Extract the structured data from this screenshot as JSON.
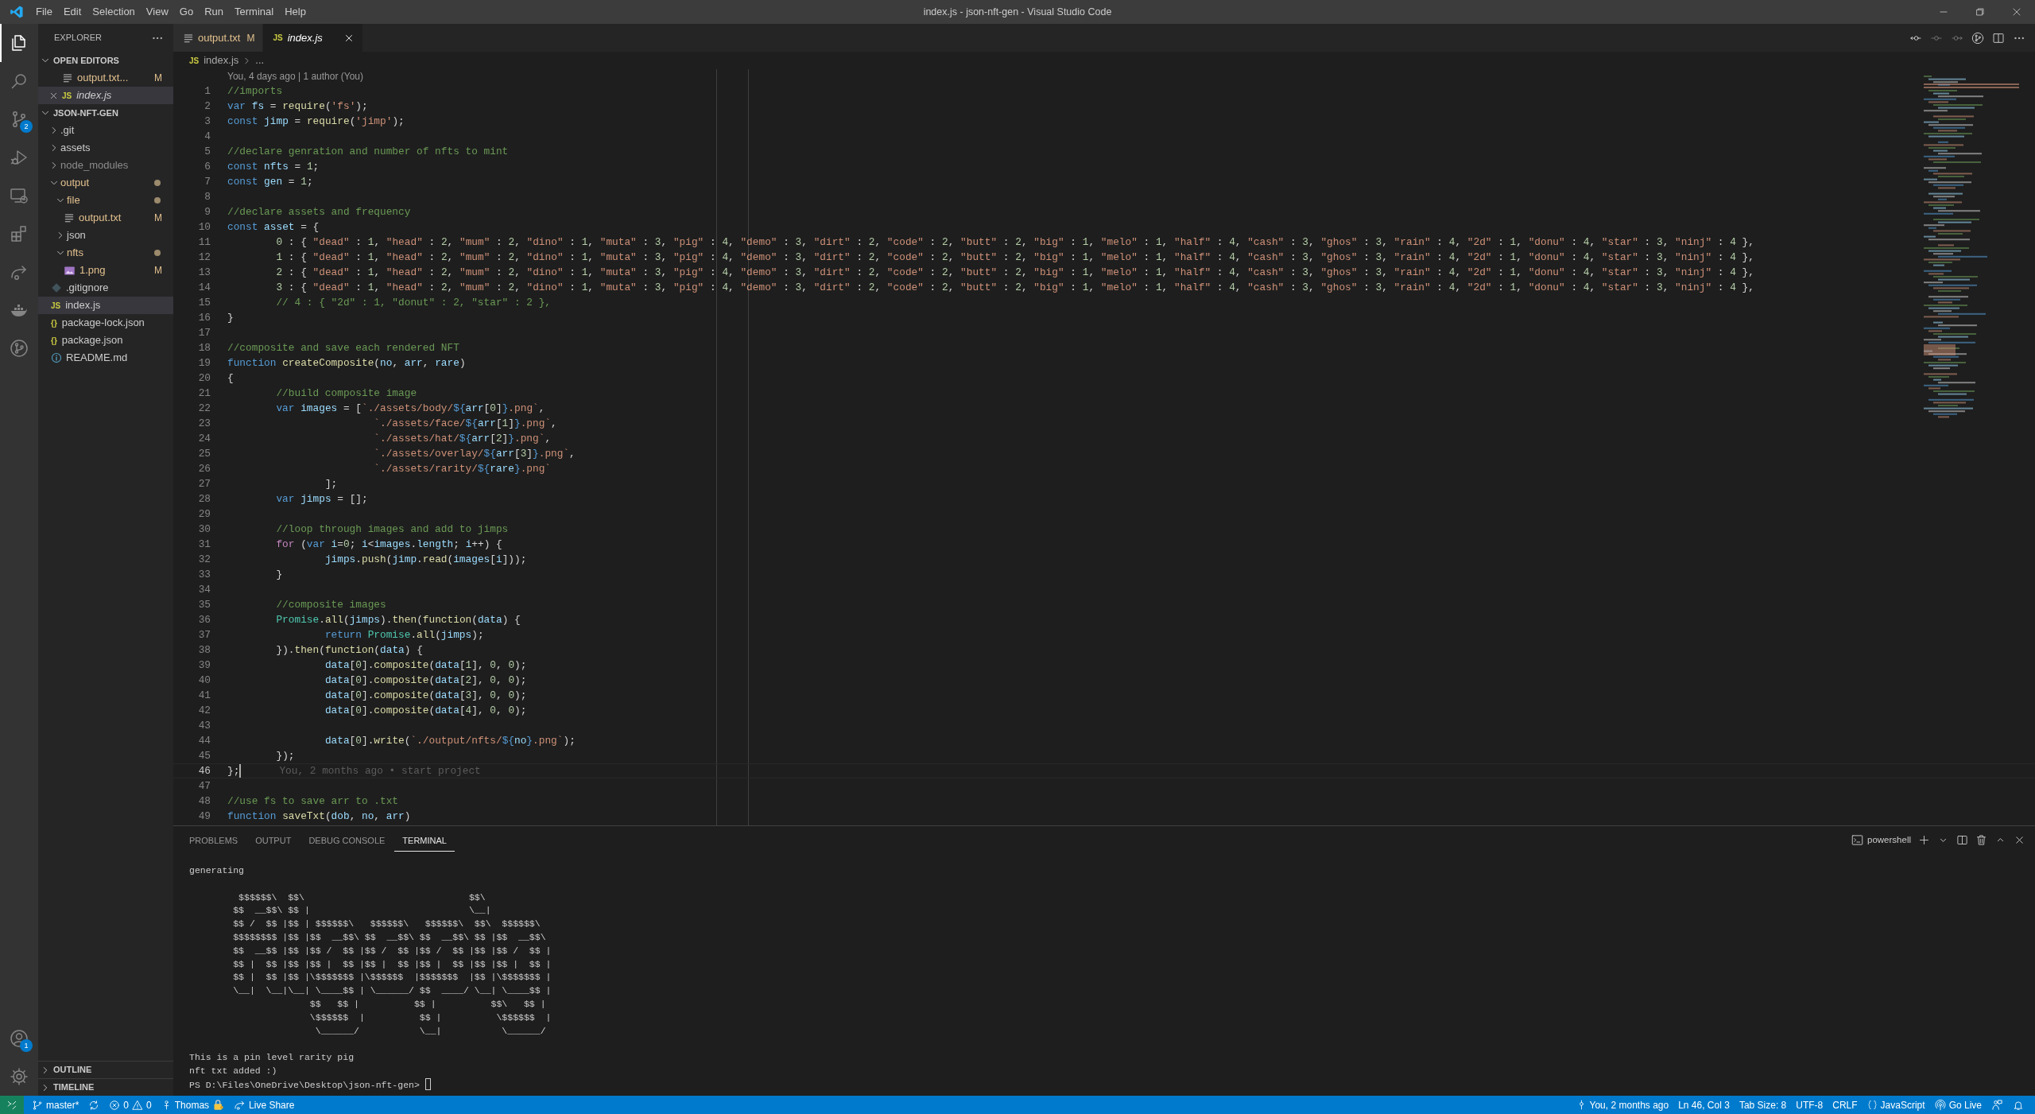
{
  "window": {
    "title": "index.js - json-nft-gen - Visual Studio Code"
  },
  "menu": [
    "File",
    "Edit",
    "Selection",
    "View",
    "Go",
    "Run",
    "Terminal",
    "Help"
  ],
  "activity_bar": {
    "items": [
      {
        "selected": true
      },
      {
        "selected": false
      },
      {
        "selected": false,
        "badge": "2"
      },
      {
        "selected": false
      },
      {
        "selected": false
      },
      {
        "selected": false
      },
      {
        "selected": false
      },
      {
        "selected": false
      },
      {
        "selected": false
      }
    ],
    "bottom": [
      {
        "selected": false,
        "badge": "1"
      },
      {
        "selected": false
      }
    ]
  },
  "sidebar": {
    "title": "EXPLORER",
    "open_editors": {
      "title": "OPEN EDITORS",
      "expanded": true,
      "items": [
        {
          "label": "output.txt...",
          "kind": "text-file",
          "modified": true,
          "ignored": false,
          "badge": "M",
          "selected": false,
          "preview": false
        },
        {
          "label": "index.js",
          "kind": "script-file",
          "glyph": "JS",
          "modified": false,
          "ignored": false,
          "selected": true,
          "preview": true
        }
      ]
    },
    "project": {
      "title": "JSON-NFT-GEN",
      "expanded": true,
      "items": [
        {
          "label": ".git",
          "kind": "folder",
          "expanded": false,
          "modified": false,
          "ignored": false,
          "selected": false
        },
        {
          "label": "assets",
          "kind": "folder",
          "expanded": false,
          "modified": false,
          "ignored": false,
          "selected": false
        },
        {
          "label": "node_modules",
          "kind": "folder",
          "expanded": false,
          "modified": false,
          "ignored": true,
          "selected": false
        },
        {
          "label": "output",
          "kind": "folder",
          "expanded": true,
          "modified": true,
          "ignored": false,
          "selected": false,
          "children": [
            {
              "label": "file",
              "kind": "folder",
              "expanded": true,
              "modified": true,
              "ignored": false,
              "selected": false,
              "children": [
                {
                  "label": "output.txt",
                  "kind": "text-file",
                  "modified": true,
                  "ignored": false,
                  "badge": "M",
                  "selected": false
                }
              ]
            },
            {
              "label": "json",
              "kind": "folder",
              "expanded": false,
              "modified": false,
              "ignored": false,
              "selected": false
            },
            {
              "label": "nfts",
              "kind": "folder",
              "expanded": true,
              "modified": true,
              "ignored": false,
              "selected": false,
              "children": [
                {
                  "label": "1.png",
                  "kind": "image-file",
                  "modified": true,
                  "ignored": false,
                  "badge": "M",
                  "selected": false
                }
              ]
            }
          ]
        },
        {
          "label": ".gitignore",
          "kind": "config-file",
          "modified": false,
          "ignored": false,
          "selected": false
        },
        {
          "label": "index.js",
          "kind": "script-file",
          "glyph": "JS",
          "modified": false,
          "ignored": false,
          "selected": true
        },
        {
          "label": "package-lock.json",
          "kind": "data-file",
          "glyph": "{}",
          "modified": false,
          "ignored": false,
          "selected": false
        },
        {
          "label": "package.json",
          "kind": "data-file",
          "glyph": "{}",
          "modified": false,
          "ignored": false,
          "selected": false
        },
        {
          "label": "README.md",
          "kind": "doc-file",
          "modified": false,
          "ignored": false,
          "selected": false
        }
      ]
    },
    "bottom_sections": [
      {
        "title": "OUTLINE",
        "expanded": false
      },
      {
        "title": "TIMELINE",
        "expanded": false
      }
    ]
  },
  "tabs": [
    {
      "label": "output.txt",
      "kind": "text-file",
      "modified": true,
      "badge": "M",
      "selected": false,
      "preview": false
    },
    {
      "label": "index.js",
      "kind": "script-file",
      "glyph": "JS",
      "modified": false,
      "selected": true,
      "preview": true
    }
  ],
  "breadcrumb": {
    "kind": "script-file",
    "glyph": "JS",
    "items": [
      "index.js",
      "..."
    ]
  },
  "editor": {
    "codelens": "You, 4 days ago | 1 author (You)",
    "lines": [
      {
        "number": "1",
        "current": false,
        "text": "//imports"
      },
      {
        "number": "2",
        "current": false,
        "text": "var fs = require('fs');"
      },
      {
        "number": "3",
        "current": false,
        "text": "const jimp = require('jimp');"
      },
      {
        "number": "4",
        "current": false
      },
      {
        "number": "5",
        "current": false,
        "text": "//declare genration and number of nfts to mint"
      },
      {
        "number": "6",
        "current": false,
        "text": "const nfts = 1;"
      },
      {
        "number": "7",
        "current": false,
        "text": "const gen = 1;"
      },
      {
        "number": "8",
        "current": false
      },
      {
        "number": "9",
        "current": false,
        "text": "//declare assets and frequency"
      },
      {
        "number": "10",
        "current": false,
        "text": "const asset = {"
      },
      {
        "number": "11",
        "current": false,
        "text": "\t0 : { \"dead\" : 1, \"head\" : 2, \"mum\" : 2, \"dino\" : 1, \"muta\" : 3, \"pig\" : 4, \"demo\" : 3, \"dirt\" : 2, \"code\" : 2, \"butt\" : 2, \"big\" : 1, \"melo\" : 1, \"half\" : 4, \"cash\" : 3, \"ghos\" : 3, \"rain\" : 4, \"2d\" : 1, \"donu\" : 4, \"star\" : 3, \"ninj\" : 4 },"
      },
      {
        "number": "12",
        "current": false,
        "text": "\t1 : { \"dead\" : 1, \"head\" : 2, \"mum\" : 2, \"dino\" : 1, \"muta\" : 3, \"pig\" : 4, \"demo\" : 3, \"dirt\" : 2, \"code\" : 2, \"butt\" : 2, \"big\" : 1, \"melo\" : 1, \"half\" : 4, \"cash\" : 3, \"ghos\" : 3, \"rain\" : 4, \"2d\" : 1, \"donu\" : 4, \"star\" : 3, \"ninj\" : 4 },"
      },
      {
        "number": "13",
        "current": false,
        "text": "\t2 : { \"dead\" : 1, \"head\" : 2, \"mum\" : 2, \"dino\" : 1, \"muta\" : 3, \"pig\" : 4, \"demo\" : 3, \"dirt\" : 2, \"code\" : 2, \"butt\" : 2, \"big\" : 1, \"melo\" : 1, \"half\" : 4, \"cash\" : 3, \"ghos\" : 3, \"rain\" : 4, \"2d\" : 1, \"donu\" : 4, \"star\" : 3, \"ninj\" : 4 },"
      },
      {
        "number": "14",
        "current": false,
        "text": "\t3 : { \"dead\" : 1, \"head\" : 2, \"mum\" : 2, \"dino\" : 1, \"muta\" : 3, \"pig\" : 4, \"demo\" : 3, \"dirt\" : 2, \"code\" : 2, \"butt\" : 2, \"big\" : 1, \"melo\" : 1, \"half\" : 4, \"cash\" : 3, \"ghos\" : 3, \"rain\" : 4, \"2d\" : 1, \"donu\" : 4, \"star\" : 3, \"ninj\" : 4 },"
      },
      {
        "number": "15",
        "current": false,
        "text": "\t// 4 : { \"2d\" : 1, \"donut\" : 2, \"star\" : 2 },"
      },
      {
        "number": "16",
        "current": false,
        "text": "}"
      },
      {
        "number": "17",
        "current": false
      },
      {
        "number": "18",
        "current": false,
        "text": "//composite and save each rendered NFT"
      },
      {
        "number": "19",
        "current": false,
        "text": "function createComposite(no, arr, rare)"
      },
      {
        "number": "20",
        "current": false,
        "text": "{"
      },
      {
        "number": "21",
        "current": false,
        "text": "\t//build composite image"
      },
      {
        "number": "22",
        "current": false,
        "text": "\tvar images = [`./assets/body/${arr[0]}.png`,"
      },
      {
        "number": "23",
        "current": false,
        "text": "\t\t        `./assets/face/${arr[1]}.png`,"
      },
      {
        "number": "24",
        "current": false,
        "text": "\t\t        `./assets/hat/${arr[2]}.png`,"
      },
      {
        "number": "25",
        "current": false,
        "text": "\t\t        `./assets/overlay/${arr[3]}.png`,"
      },
      {
        "number": "26",
        "current": false,
        "text": "\t\t        `./assets/rarity/${rare}.png`"
      },
      {
        "number": "27",
        "current": false,
        "text": "\t\t];"
      },
      {
        "number": "28",
        "current": false,
        "text": "\tvar jimps = [];"
      },
      {
        "number": "29",
        "current": false
      },
      {
        "number": "30",
        "current": false,
        "text": "\t//loop through images and add to jimps"
      },
      {
        "number": "31",
        "current": false,
        "text": "\tfor (var i=0; i<images.length; i++) {"
      },
      {
        "number": "32",
        "current": false,
        "text": "\t\tjimps.push(jimp.read(images[i]));"
      },
      {
        "number": "33",
        "current": false,
        "text": "\t}"
      },
      {
        "number": "34",
        "current": false
      },
      {
        "number": "35",
        "current": false,
        "text": "\t//composite images"
      },
      {
        "number": "36",
        "current": false,
        "text": "\tPromise.all(jimps).then(function(data) {"
      },
      {
        "number": "37",
        "current": false,
        "text": "\t\treturn Promise.all(jimps);"
      },
      {
        "number": "38",
        "current": false,
        "text": "\t}).then(function(data) {"
      },
      {
        "number": "39",
        "current": false,
        "text": "\t\tdata[0].composite(data[1], 0, 0);"
      },
      {
        "number": "40",
        "current": false,
        "text": "\t\tdata[0].composite(data[2], 0, 0);"
      },
      {
        "number": "41",
        "current": false,
        "text": "\t\tdata[0].composite(data[3], 0, 0);"
      },
      {
        "number": "42",
        "current": false,
        "text": "\t\tdata[0].composite(data[4], 0, 0);"
      },
      {
        "number": "43",
        "current": false
      },
      {
        "number": "44",
        "current": false,
        "text": "\t\tdata[0].write(`./output/nfts/${no}.png`);"
      },
      {
        "number": "45",
        "current": false,
        "text": "\t});"
      },
      {
        "number": "46",
        "current": true,
        "text": "};",
        "blame": "You, 2 months ago • start project"
      },
      {
        "number": "47",
        "current": false
      },
      {
        "number": "48",
        "current": false,
        "text": "//use fs to save arr to .txt"
      },
      {
        "number": "49",
        "current": false,
        "text": "function saveTxt(dob, no, arr)"
      }
    ]
  },
  "panel": {
    "tabs": [
      {
        "label": "PROBLEMS",
        "selected": false
      },
      {
        "label": "OUTPUT",
        "selected": false
      },
      {
        "label": "DEBUG CONSOLE",
        "selected": false
      },
      {
        "label": "TERMINAL",
        "selected": true
      }
    ],
    "shell": "powershell",
    "terminal": {
      "blocks": [
        {
          "lines": [
            "generating"
          ]
        },
        {
          "lines": [
            "         $$$$$$\\  $$\\                              $$\\",
            "        $$  __$$\\ $$ |                             \\__|",
            "        $$ /  $$ |$$ | $$$$$$\\   $$$$$$\\   $$$$$$\\  $$\\  $$$$$$\\",
            "        $$$$$$$$ |$$ |$$  __$$\\ $$  __$$\\ $$  __$$\\ $$ |$$  __$$\\",
            "        $$  __$$ |$$ |$$ /  $$ |$$ /  $$ |$$ /  $$ |$$ |$$ /  $$ |",
            "        $$ |  $$ |$$ |$$ |  $$ |$$ |  $$ |$$ |  $$ |$$ |$$ |  $$ |",
            "        $$ |  $$ |$$ |\\$$$$$$$ |\\$$$$$$  |$$$$$$$  |$$ |\\$$$$$$$ |",
            "        \\__|  \\__|\\__| \\____$$ | \\______/ $$  ____/ \\__| \\____$$ |",
            "                      $$   $$ |          $$ |          $$\\   $$ |",
            "                      \\$$$$$$  |          $$ |          \\$$$$$$  |",
            "                       \\______/           \\__|           \\______/"
          ]
        },
        {
          "lines": [
            "This is a pin level rarity pig",
            "nft txt added :)"
          ]
        }
      ],
      "prompt": "PS D:\\Files\\OneDrive\\Desktop\\json-nft-gen>"
    }
  },
  "status_bar": {
    "left": [
      {
        "kind": "remote"
      },
      {
        "kind": "branch",
        "text": "master*"
      },
      {
        "kind": "sync"
      },
      {
        "kind": "problems",
        "errors": "0",
        "warnings": "0"
      },
      {
        "kind": "user",
        "text": "Thomas"
      },
      {
        "kind": "share",
        "text": "Live Share"
      }
    ],
    "right": [
      {
        "kind": "blame",
        "text": "You, 2 months ago"
      },
      {
        "kind": "plain",
        "text": "Ln 46, Col 3"
      },
      {
        "kind": "plain",
        "text": "Tab Size: 8"
      },
      {
        "kind": "plain",
        "text": "UTF-8"
      },
      {
        "kind": "plain",
        "text": "CRLF"
      },
      {
        "kind": "language",
        "text": "JavaScript"
      },
      {
        "kind": "live",
        "text": "Go Live"
      },
      {
        "kind": "feedback"
      },
      {
        "kind": "bell"
      }
    ]
  }
}
